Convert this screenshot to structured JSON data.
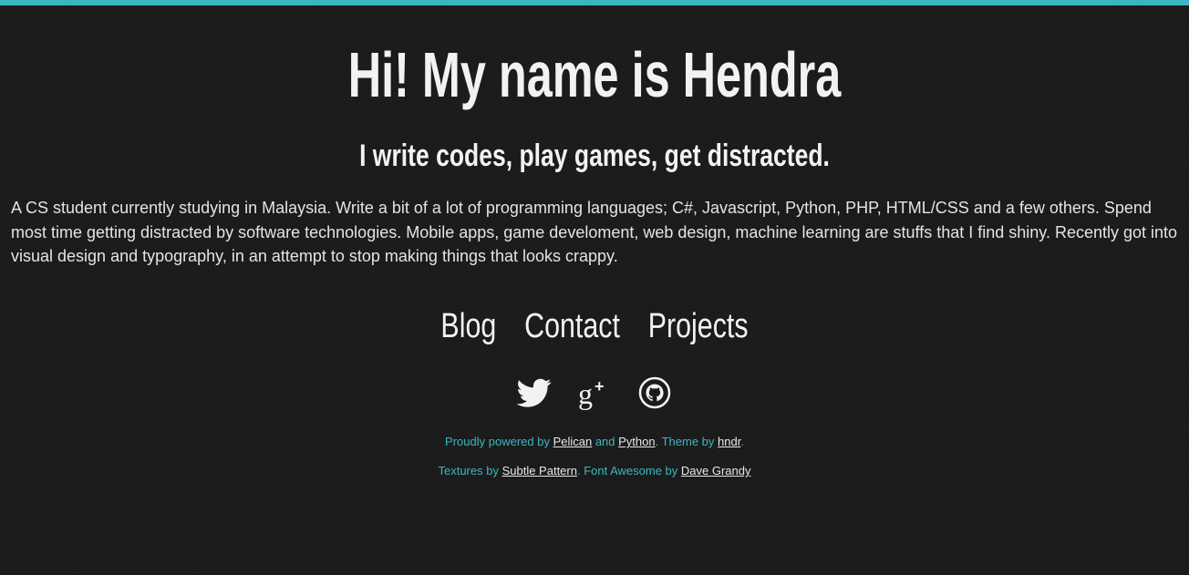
{
  "colors": {
    "accent": "#3bb7bf",
    "background": "#1b1b1b",
    "text": "#f2f2f2"
  },
  "header": {
    "title": "Hi! My name is Hendra",
    "tagline": "I write codes, play games, get distracted."
  },
  "bio": "A CS student currently studying in Malaysia. Write a bit of a lot of programming languages; C#, Javascript, Python, PHP, HTML/CSS and a few others. Spend most time getting distracted by software technologies. Mobile apps, game develoment, web design, machine learning are stuffs that I find shiny. Recently got into visual design and typography, in an attempt to stop making things that looks crappy.",
  "nav": {
    "items": [
      {
        "label": "Blog"
      },
      {
        "label": "Contact"
      },
      {
        "label": "Projects"
      }
    ]
  },
  "social": {
    "icons": [
      "twitter-icon",
      "google-plus-icon",
      "github-icon"
    ]
  },
  "footer": {
    "line1": {
      "powered_by": "Proudly powered by ",
      "pelican": "Pelican",
      "and": " and ",
      "python": "Python",
      "theme_by": ". Theme by ",
      "hndr": "hndr",
      "end": "."
    },
    "line2": {
      "textures_by": "Textures by ",
      "subtle_pattern": "Subtle Pattern",
      "font_awesome_by": ". Font Awesome by ",
      "dave_grandy": "Dave Grandy"
    }
  }
}
